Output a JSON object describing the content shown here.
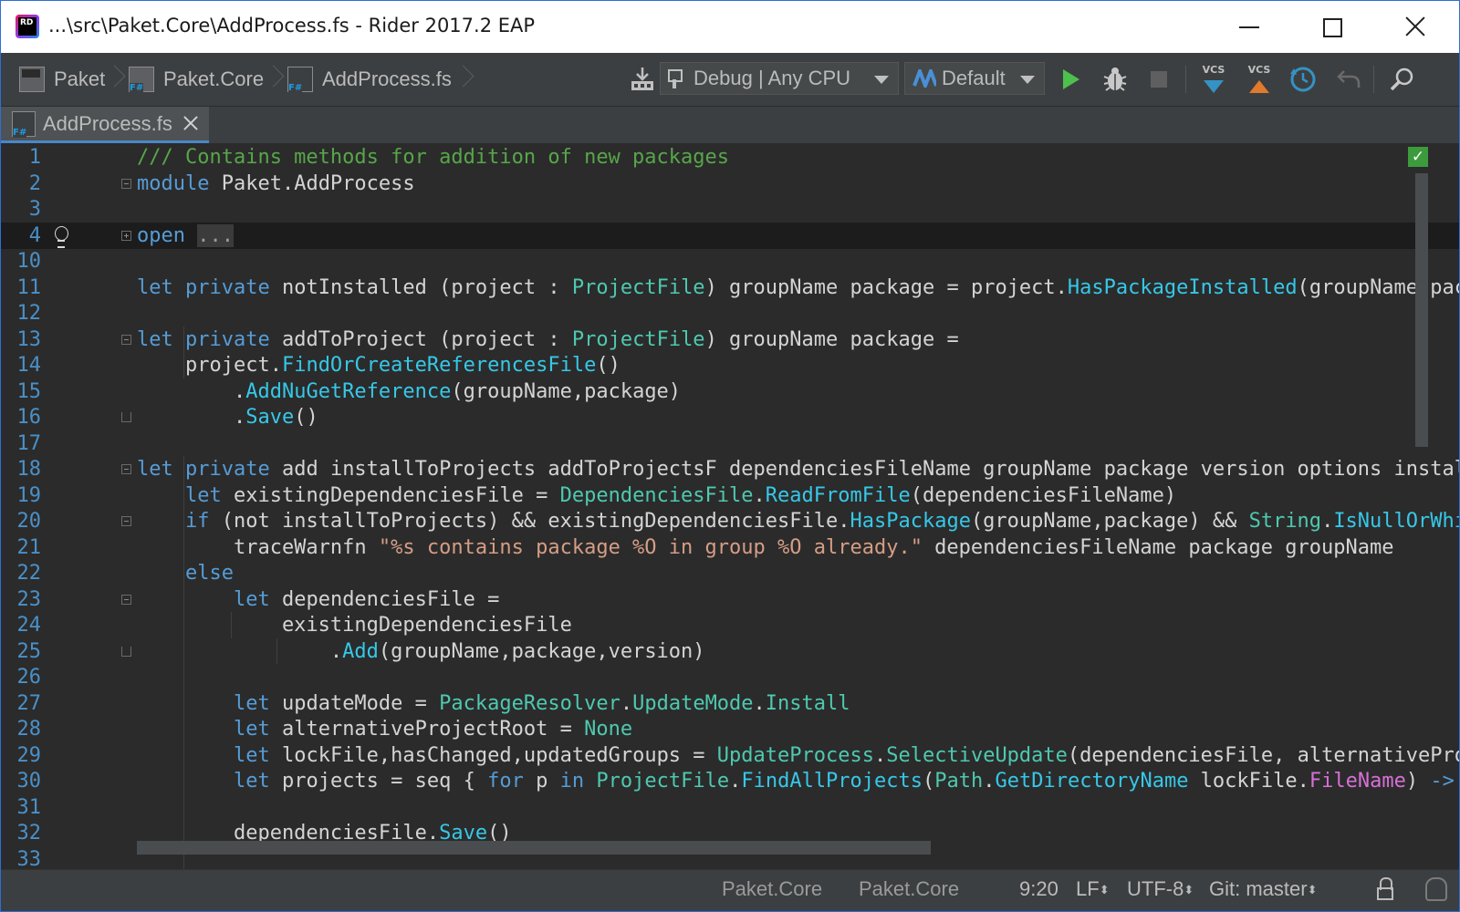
{
  "window": {
    "title": "...\\src\\Paket.Core\\AddProcess.fs - Rider 2017.2 EAP",
    "logo_text": "RD"
  },
  "breadcrumbs": [
    {
      "label": "Paket",
      "icon": "solution-icon"
    },
    {
      "label": "Paket.Core",
      "icon": "fsharp-project-icon"
    },
    {
      "label": "AddProcess.fs",
      "icon": "fsharp-file-icon"
    }
  ],
  "toolbar": {
    "build_config": "Debug | Any CPU",
    "run_config": "Default",
    "vcs_label": "VCS"
  },
  "tab": {
    "label": "AddProcess.fs"
  },
  "code_lines": [
    {
      "n": "1",
      "html": "<span class=\"c-com\">/// Contains methods for addition of new packages</span>"
    },
    {
      "n": "2",
      "html": "<span class=\"c-kw\">module</span> Paket.AddProcess",
      "fold": "open"
    },
    {
      "n": "3",
      "html": ""
    },
    {
      "n": "4",
      "html": "<span class=\"c-kw\">open</span> <span class=\"c-fold\">...</span>",
      "fold": "closed",
      "current": true,
      "bulb": true
    },
    {
      "n": "10",
      "html": ""
    },
    {
      "n": "11",
      "html": "<span class=\"c-kw\">let</span> <span class=\"c-kw\">private</span> notInstalled (project : <span class=\"c-type\">ProjectFile</span>) groupName package = project.<span class=\"c-method\">HasPackageInstalled</span>(groupName,package)"
    },
    {
      "n": "12",
      "html": ""
    },
    {
      "n": "13",
      "html": "<span class=\"c-kw\">let</span> <span class=\"c-kw\">private</span> addToProject (project : <span class=\"c-type\">ProjectFile</span>) groupName package =",
      "fold": "open"
    },
    {
      "n": "14",
      "html": "    project.<span class=\"c-method\">FindOrCreateReferencesFile</span>()"
    },
    {
      "n": "15",
      "html": "        .<span class=\"c-method\">AddNuGetReference</span>(groupName,package)"
    },
    {
      "n": "16",
      "html": "        .<span class=\"c-method\">Save</span>()",
      "fold": "end"
    },
    {
      "n": "17",
      "html": ""
    },
    {
      "n": "18",
      "html": "<span class=\"c-kw\">let</span> <span class=\"c-kw\">private</span> add installToProjects addToProjectsF dependenciesFileName groupName package version options installAfter =",
      "fold": "open"
    },
    {
      "n": "19",
      "html": "    <span class=\"c-kw\">let</span> existingDependenciesFile = <span class=\"c-type\">DependenciesFile</span>.<span class=\"c-method\">ReadFromFile</span>(dependenciesFileName)"
    },
    {
      "n": "20",
      "html": "    <span class=\"c-kw\">if</span> (not installToProjects) &amp;&amp; existingDependenciesFile.<span class=\"c-method\">HasPackage</span>(groupName,package) &amp;&amp; <span class=\"c-type\">String</span>.<span class=\"c-method\">IsNullOrWhiteSpace</span>",
      "fold": "open"
    },
    {
      "n": "21",
      "html": "        traceWarnfn <span class=\"c-str\">\"%s contains package %O in group %O already.\"</span> dependenciesFileName package groupName"
    },
    {
      "n": "22",
      "html": "    <span class=\"c-kw\">else</span>"
    },
    {
      "n": "23",
      "html": "        <span class=\"c-kw\">let</span> dependenciesFile =",
      "fold": "open"
    },
    {
      "n": "24",
      "html": "            existingDependenciesFile"
    },
    {
      "n": "25",
      "html": "                .<span class=\"c-method\">Add</span>(groupName,package,version)",
      "fold": "end"
    },
    {
      "n": "26",
      "html": ""
    },
    {
      "n": "27",
      "html": "        <span class=\"c-kw\">let</span> updateMode = <span class=\"c-type\">PackageResolver</span>.<span class=\"c-type\">UpdateMode</span>.<span class=\"c-type\">Install</span>"
    },
    {
      "n": "28",
      "html": "        <span class=\"c-kw\">let</span> alternativeProjectRoot = <span class=\"c-type\">None</span>"
    },
    {
      "n": "29",
      "html": "        <span class=\"c-kw\">let</span> lockFile,hasChanged,updatedGroups = <span class=\"c-type\">UpdateProcess</span>.<span class=\"c-type\">SelectiveUpdate</span>(dependenciesFile, alternativeProjectRoot"
    },
    {
      "n": "30",
      "html": "        <span class=\"c-kw\">let</span> projects = seq { <span class=\"c-kw\">for</span> p <span class=\"c-kw\">in</span> <span class=\"c-type\">ProjectFile</span>.<span class=\"c-method\">FindAllProjects</span>(<span class=\"c-type\">Path</span>.<span class=\"c-method\">GetDirectoryName</span> lockFile.<span class=\"c-prop\">FileName</span>) <span class=\"c-kw\">-&gt;</span> p }"
    },
    {
      "n": "31",
      "html": ""
    },
    {
      "n": "32",
      "html": "        dependenciesFile.<span class=\"c-method\">Save</span>()"
    },
    {
      "n": "33",
      "html": ""
    }
  ],
  "statusbar": {
    "project1": "Paket.Core",
    "project2": "Paket.Core",
    "caret": "9:20",
    "line_sep": "LF",
    "encoding": "UTF-8",
    "git": "Git: master"
  }
}
